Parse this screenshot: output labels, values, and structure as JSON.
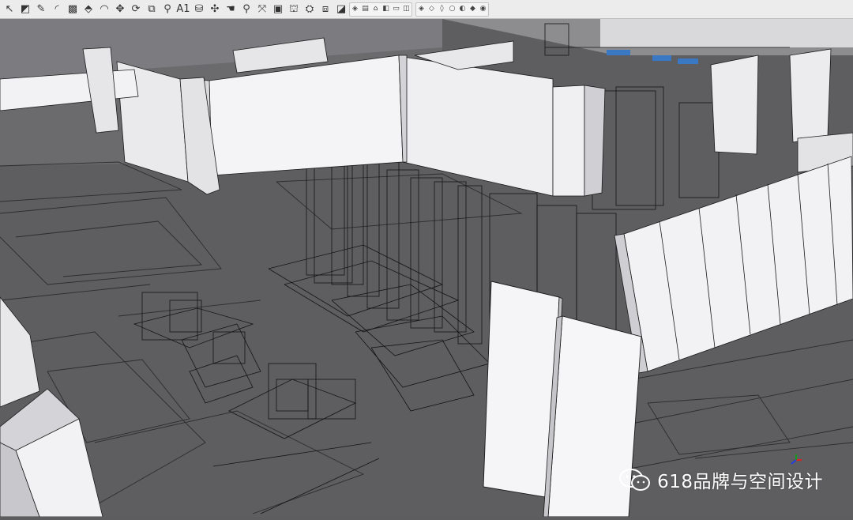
{
  "toolbar": {
    "tools": [
      {
        "name": "select-tool-icon",
        "glyph": "↖"
      },
      {
        "name": "eraser-tool-icon",
        "glyph": "◩"
      },
      {
        "name": "line-tool-icon",
        "glyph": "✎"
      },
      {
        "name": "arc-tool-icon",
        "glyph": "◜"
      },
      {
        "name": "rectangle-tool-icon",
        "glyph": "▩"
      },
      {
        "name": "push-pull-tool-icon",
        "glyph": "⬘"
      },
      {
        "name": "offset-tool-icon",
        "glyph": "◠"
      },
      {
        "name": "move-tool-icon",
        "glyph": "✥"
      },
      {
        "name": "rotate-tool-icon",
        "glyph": "⟳"
      },
      {
        "name": "scale-tool-icon",
        "glyph": "⧉"
      },
      {
        "name": "tape-measure-tool-icon",
        "glyph": "⚲"
      },
      {
        "name": "text-tool-icon",
        "glyph": "A1"
      },
      {
        "name": "paint-bucket-tool-icon",
        "glyph": "⛁"
      },
      {
        "name": "orbit-tool-icon",
        "glyph": "✣"
      },
      {
        "name": "pan-tool-icon",
        "glyph": "☚"
      },
      {
        "name": "zoom-tool-icon",
        "glyph": "⚲"
      },
      {
        "name": "zoom-extents-tool-icon",
        "glyph": "⤧"
      },
      {
        "name": "components-tool-icon",
        "glyph": "▣"
      },
      {
        "name": "warehouse-tool-icon",
        "glyph": "⛫"
      },
      {
        "name": "extension-warehouse-icon",
        "glyph": "⛭"
      },
      {
        "name": "layout-tool-icon",
        "glyph": "⧈"
      },
      {
        "name": "style-tool-icon",
        "glyph": "◪"
      }
    ],
    "views": [
      {
        "name": "iso-view-icon",
        "glyph": "◈"
      },
      {
        "name": "top-view-icon",
        "glyph": "▤"
      },
      {
        "name": "front-view-icon",
        "glyph": "⌂"
      },
      {
        "name": "right-view-icon",
        "glyph": "◧"
      },
      {
        "name": "back-view-icon",
        "glyph": "▭"
      },
      {
        "name": "left-view-icon",
        "glyph": "◫"
      }
    ],
    "styles": [
      {
        "name": "xray-style-icon",
        "glyph": "◈"
      },
      {
        "name": "back-edges-style-icon",
        "glyph": "◇"
      },
      {
        "name": "wireframe-style-icon",
        "glyph": "◊"
      },
      {
        "name": "hidden-line-style-icon",
        "glyph": "○"
      },
      {
        "name": "shaded-style-icon",
        "glyph": "◐"
      },
      {
        "name": "shaded-textures-style-icon",
        "glyph": "◆"
      },
      {
        "name": "monochrome-style-icon",
        "glyph": "◉"
      }
    ]
  },
  "watermark": {
    "text": "618品牌与空间设计"
  },
  "colors": {
    "floor": "#5d5d5f",
    "wall_face": "#f2f2f4",
    "wall_side": "#cfcfd3",
    "edge": "#111111"
  }
}
